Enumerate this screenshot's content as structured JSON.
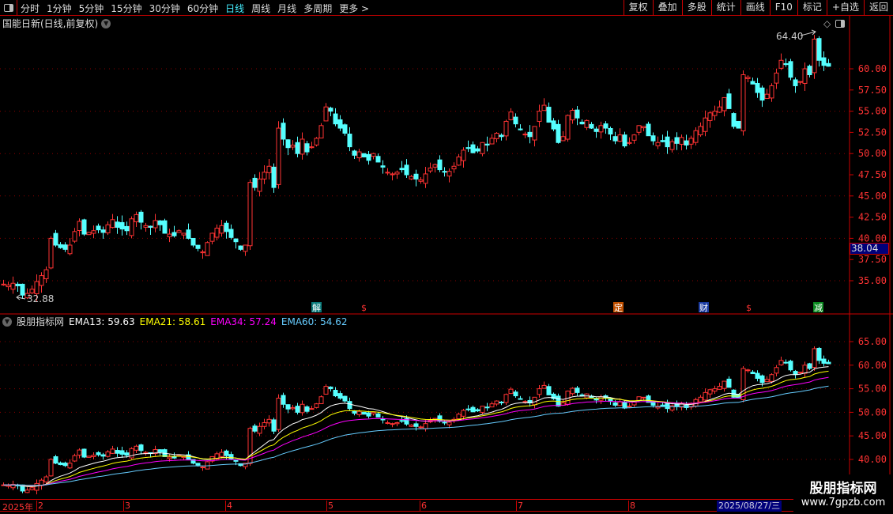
{
  "toolbar": {
    "periods": [
      "分时",
      "1分钟",
      "5分钟",
      "15分钟",
      "30分钟",
      "60分钟",
      "日线",
      "周线",
      "月线",
      "多周期",
      "更多 >"
    ],
    "active_period": "日线",
    "buttons": [
      "复权",
      "叠加",
      "多股",
      "统计",
      "画线",
      "F10",
      "标记",
      "+自选",
      "返回"
    ]
  },
  "header": {
    "title": "国能日新(日线,前复权)"
  },
  "main_chart": {
    "high_label": "64.40",
    "low_label": "32.88",
    "current_price": "38.04",
    "y_ticks": [
      "60.00",
      "57.50",
      "55.00",
      "52.50",
      "50.00",
      "47.50",
      "45.00",
      "42.50",
      "40.00",
      "37.50",
      "35.00"
    ],
    "markers": [
      {
        "text": "解",
        "color": "#0a7a7a"
      },
      {
        "text": "$",
        "color": ""
      },
      {
        "text": "定",
        "color": "#c05000"
      },
      {
        "text": "财",
        "color": "#1a3aa0"
      },
      {
        "text": "$",
        "color": ""
      },
      {
        "text": "减",
        "color": "#0a8a20"
      }
    ]
  },
  "indicator": {
    "name": "股朋指标网",
    "items": [
      {
        "label": "EMA13: 59.63",
        "color": "#ffffff"
      },
      {
        "label": "EMA21: 58.61",
        "color": "#ffff00"
      },
      {
        "label": "EMA34: 57.24",
        "color": "#ff00ff"
      },
      {
        "label": "EMA60: 54.62",
        "color": "#66ccff"
      }
    ],
    "y_ticks": [
      "65.00",
      "60.00",
      "55.00",
      "50.00",
      "45.00",
      "40.00"
    ]
  },
  "date_axis": {
    "year": "2025年",
    "months": [
      "2",
      "3",
      "4",
      "5",
      "6",
      "7",
      "8"
    ],
    "cursor_date": "2025/08/27/三"
  },
  "watermark": {
    "name": "股朋指标网",
    "url": "www.7gpzb.com"
  },
  "colors": {
    "up": "#ff3333",
    "down": "#55ffff",
    "grid": "#8b0000"
  },
  "chart_data": {
    "type": "candlestick",
    "title": "国能日新(日线,前复权)",
    "closes": [
      34.6,
      34.5,
      34.7,
      34.4,
      33.3,
      33.5,
      34.0,
      34.9,
      35.6,
      36.3,
      40.0,
      39.2,
      38.9,
      38.7,
      39.2,
      40.8,
      42.0,
      40.5,
      40.7,
      40.9,
      41.0,
      40.7,
      41.6,
      42.2,
      41.3,
      41.1,
      40.9,
      42.3,
      42.8,
      41.9,
      41.5,
      41.3,
      42.1,
      41.6,
      40.6,
      40.5,
      40.3,
      40.9,
      40.6,
      40.0,
      39.2,
      38.8,
      38.4,
      39.5,
      40.6,
      41.2,
      41.5,
      40.8,
      40.1,
      39.6,
      38.7,
      39.2,
      46.6,
      46.0,
      47.0,
      47.8,
      48.5,
      46.0,
      53.0,
      51.7,
      50.7,
      51.0,
      50.0,
      51.7,
      50.2,
      50.8,
      51.8,
      53.3,
      55.5,
      55.0,
      53.5,
      53.0,
      52.4,
      50.8,
      49.8,
      50.2,
      49.6,
      49.2,
      50.0,
      49.0,
      48.4,
      47.8,
      47.6,
      47.8,
      48.1,
      47.5,
      47.3,
      47.0,
      46.9,
      47.6,
      48.3,
      48.7,
      48.1,
      47.8,
      47.9,
      48.5,
      49.6,
      50.4,
      50.6,
      50.1,
      50.3,
      51.3,
      51.0,
      51.8,
      52.4,
      52.0,
      53.8,
      54.9,
      53.5,
      52.8,
      52.3,
      52.0,
      53.2,
      55.0,
      55.7,
      53.7,
      52.9,
      51.3,
      52.0,
      54.5,
      55.1,
      54.2,
      53.5,
      53.9,
      53.0,
      52.6,
      53.3,
      53.0,
      52.3,
      51.5,
      52.2,
      50.9,
      51.3,
      52.2,
      53.3,
      53.2,
      52.1,
      51.5,
      51.3,
      51.4,
      50.8,
      51.4,
      51.2,
      51.9,
      51.0,
      51.8,
      52.7,
      53.2,
      54.2,
      54.8,
      55.0,
      55.5,
      56.6,
      55.3,
      53.2,
      53.0,
      59.3,
      59.0,
      58.2,
      57.2,
      56.3,
      57.0,
      58.0,
      59.5,
      61.0,
      60.5,
      59.0,
      58.0,
      58.5,
      60.0,
      59.3,
      63.5,
      61.0,
      60.4,
      60.3
    ],
    "main_ylim": [
      32.5,
      65
    ],
    "indicator_ylim": [
      38,
      70
    ],
    "ema_periods": [
      13,
      21,
      34,
      60
    ]
  }
}
